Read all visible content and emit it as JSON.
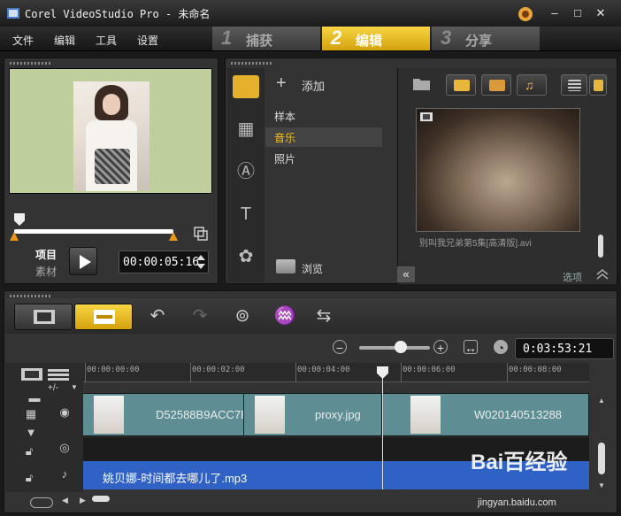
{
  "window": {
    "title": "Corel VideoStudio Pro - 未命名",
    "minimize": "–",
    "maximize": "□",
    "close": "✕"
  },
  "menu": [
    "文件",
    "编辑",
    "工具",
    "设置"
  ],
  "steps": [
    {
      "num": "1",
      "label": "捕获"
    },
    {
      "num": "2",
      "label": "编辑"
    },
    {
      "num": "3",
      "label": "分享"
    }
  ],
  "preview": {
    "mode_project": "项目",
    "mode_clip": "素材",
    "timecode": "00:00:05:16"
  },
  "library": {
    "add_label": "添加",
    "folders": [
      "样本",
      "音乐",
      "照片"
    ],
    "selected_folder": "音乐",
    "browse_label": "浏览",
    "thumbnail_caption": "别叫我兄弟第5集[高清版].avi",
    "options_label": "选项"
  },
  "timeline": {
    "project_duration": "0:03:53:21",
    "zoom_level": 0.5,
    "playhead_time": "00:00:05:16",
    "ruler_labels": [
      "00:00:00:00",
      "00:00:02:00",
      "00:00:04:00",
      "00:00:06:00",
      "00:00:08:00"
    ],
    "add_remove_label": "+/-",
    "video_clips": [
      "D52588B9ACC7E",
      "proxy.jpg",
      "W020140513288"
    ],
    "music_clip": "姚贝娜-时间都去哪儿了.mp3"
  },
  "watermark": {
    "text": "Bai百经验",
    "url": "jingyan.baidu.com"
  },
  "colors": {
    "accent": "#f4c21e",
    "music_track": "#3061c4",
    "video_clip": "#5e8d93"
  }
}
